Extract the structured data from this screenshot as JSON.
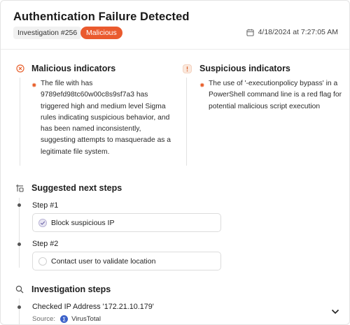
{
  "header": {
    "title": "Authentication Failure Detected",
    "investigation_tag": "Investigation #256",
    "status_badge": "Malicious",
    "timestamp": "4/18/2024 at 7:27:05 AM"
  },
  "malicious": {
    "title": "Malicious indicators",
    "items": [
      "The file with has 9789efd98tc60w00c8s9sf7a3 has triggered high and medium level Sigma rules indicating suspicious behavior, and has been named inconsistently, suggesting attempts to masquerade as a legitimate file system."
    ]
  },
  "suspicious": {
    "title": "Suspicious indicators",
    "items": [
      "The use of '-executionpolicy bypass' in a PowerShell command line is a red flag for potential malicious script execution"
    ]
  },
  "next_steps": {
    "title": "Suggested next steps",
    "steps": [
      {
        "label": "Step #1",
        "action": "Block suspicious IP",
        "done": true
      },
      {
        "label": "Step #2",
        "action": "Contact user to validate location",
        "done": false
      }
    ]
  },
  "investigation": {
    "title": "Investigation steps",
    "items": [
      {
        "text": "Checked IP Address '172.21.10.179'",
        "source_label": "Source:",
        "source_name": "VirusTotal"
      }
    ]
  },
  "colors": {
    "accent_orange": "#ea5a2e",
    "text_primary": "#1f1f1f",
    "border": "#e4e4e4"
  },
  "icons": [
    "calendar-icon",
    "malicious-indicator-icon",
    "suspicious-indicator-icon",
    "next-steps-icon",
    "search-icon",
    "check-icon",
    "virustotal-icon",
    "chevron-down-icon"
  ]
}
